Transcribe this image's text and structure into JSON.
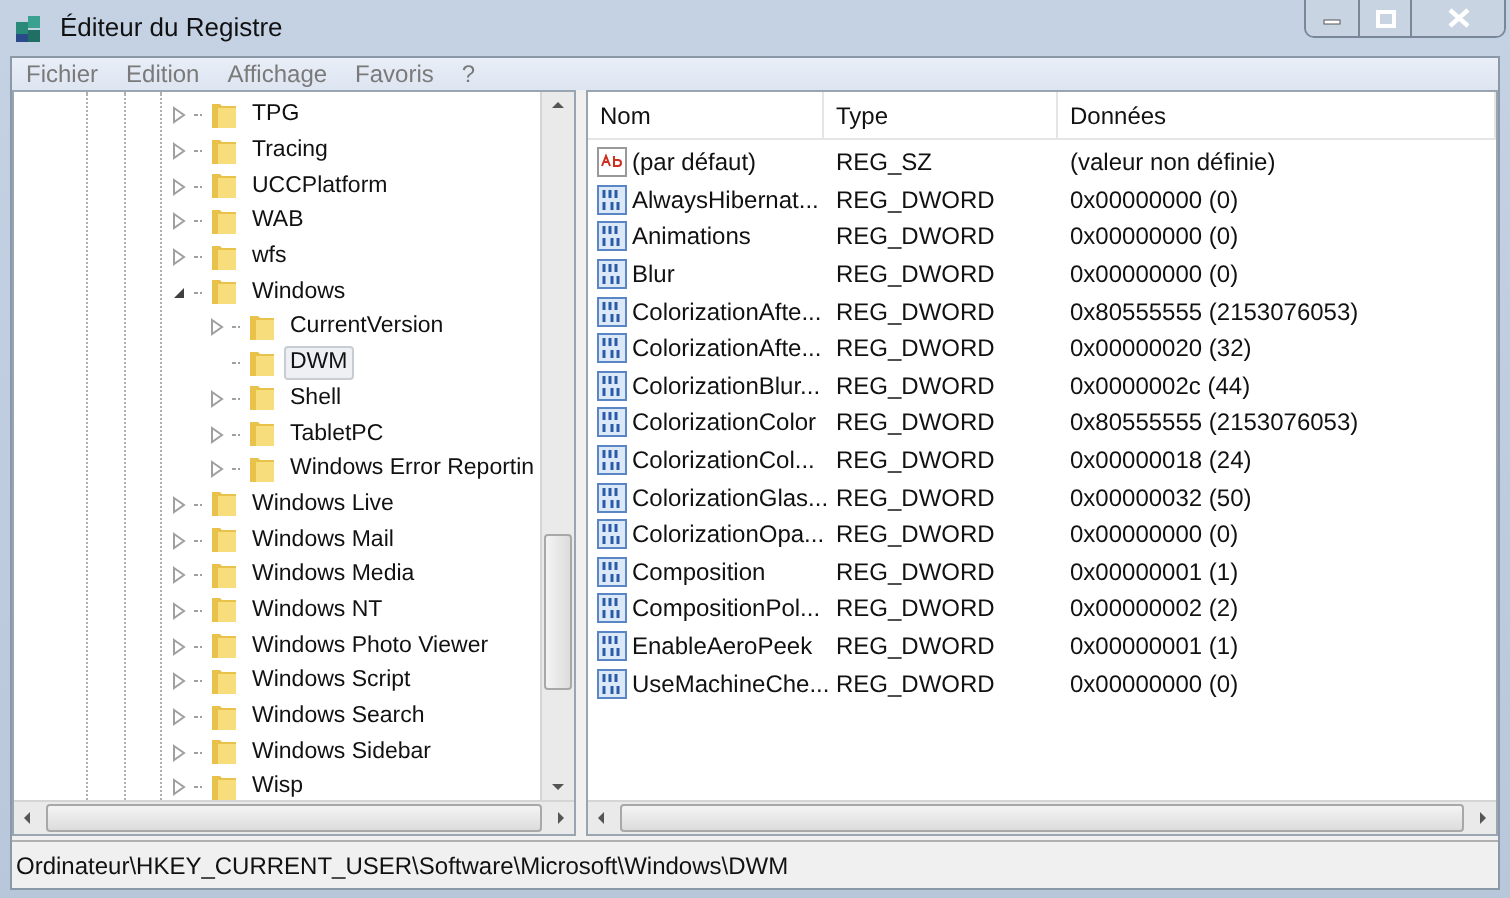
{
  "window": {
    "title": "Éditeur du Registre"
  },
  "menu": [
    "Fichier",
    "Edition",
    "Affichage",
    "Favoris",
    "?"
  ],
  "tree": [
    {
      "label": "TPG",
      "has_children": true,
      "expanded": false,
      "selected": false
    },
    {
      "label": "Tracing",
      "has_children": true,
      "expanded": false,
      "selected": false
    },
    {
      "label": "UCCPlatform",
      "has_children": true,
      "expanded": false,
      "selected": false
    },
    {
      "label": "WAB",
      "has_children": true,
      "expanded": false,
      "selected": false
    },
    {
      "label": "wfs",
      "has_children": true,
      "expanded": false,
      "selected": false
    },
    {
      "label": "Windows",
      "has_children": true,
      "expanded": true,
      "selected": false,
      "children": [
        {
          "label": "CurrentVersion",
          "has_children": true,
          "expanded": false,
          "selected": false
        },
        {
          "label": "DWM",
          "has_children": false,
          "selected": true
        },
        {
          "label": "Shell",
          "has_children": true,
          "expanded": false,
          "selected": false
        },
        {
          "label": "TabletPC",
          "has_children": true,
          "expanded": false,
          "selected": false
        },
        {
          "label": "Windows Error Reportin",
          "has_children": true,
          "expanded": false,
          "selected": false
        }
      ]
    },
    {
      "label": "Windows Live",
      "has_children": true,
      "expanded": false,
      "selected": false
    },
    {
      "label": "Windows Mail",
      "has_children": true,
      "expanded": false,
      "selected": false
    },
    {
      "label": "Windows Media",
      "has_children": true,
      "expanded": false,
      "selected": false
    },
    {
      "label": "Windows NT",
      "has_children": true,
      "expanded": false,
      "selected": false
    },
    {
      "label": "Windows Photo Viewer",
      "has_children": true,
      "expanded": false,
      "selected": false
    },
    {
      "label": "Windows Script",
      "has_children": true,
      "expanded": false,
      "selected": false
    },
    {
      "label": "Windows Search",
      "has_children": true,
      "expanded": false,
      "selected": false
    },
    {
      "label": "Windows Sidebar",
      "has_children": true,
      "expanded": false,
      "selected": false
    },
    {
      "label": "Wisp",
      "has_children": true,
      "expanded": false,
      "selected": false
    }
  ],
  "table": {
    "columns": [
      "Nom",
      "Type",
      "Données"
    ],
    "rows": [
      {
        "kind": "string",
        "name": "(par défaut)",
        "type": "REG_SZ",
        "data": "(valeur non définie)"
      },
      {
        "kind": "dword",
        "name": "AlwaysHibernat...",
        "type": "REG_DWORD",
        "data": "0x00000000 (0)"
      },
      {
        "kind": "dword",
        "name": "Animations",
        "type": "REG_DWORD",
        "data": "0x00000000 (0)"
      },
      {
        "kind": "dword",
        "name": "Blur",
        "type": "REG_DWORD",
        "data": "0x00000000 (0)"
      },
      {
        "kind": "dword",
        "name": "ColorizationAfte...",
        "type": "REG_DWORD",
        "data": "0x80555555 (2153076053)"
      },
      {
        "kind": "dword",
        "name": "ColorizationAfte...",
        "type": "REG_DWORD",
        "data": "0x00000020 (32)"
      },
      {
        "kind": "dword",
        "name": "ColorizationBlur...",
        "type": "REG_DWORD",
        "data": "0x0000002c (44)"
      },
      {
        "kind": "dword",
        "name": "ColorizationColor",
        "type": "REG_DWORD",
        "data": "0x80555555 (2153076053)"
      },
      {
        "kind": "dword",
        "name": "ColorizationCol...",
        "type": "REG_DWORD",
        "data": "0x00000018 (24)"
      },
      {
        "kind": "dword",
        "name": "ColorizationGlas...",
        "type": "REG_DWORD",
        "data": "0x00000032 (50)"
      },
      {
        "kind": "dword",
        "name": "ColorizationOpa...",
        "type": "REG_DWORD",
        "data": "0x00000000 (0)"
      },
      {
        "kind": "dword",
        "name": "Composition",
        "type": "REG_DWORD",
        "data": "0x00000001 (1)"
      },
      {
        "kind": "dword",
        "name": "CompositionPol...",
        "type": "REG_DWORD",
        "data": "0x00000002 (2)"
      },
      {
        "kind": "dword",
        "name": "EnableAeroPeek",
        "type": "REG_DWORD",
        "data": "0x00000001 (1)"
      },
      {
        "kind": "dword",
        "name": "UseMachineChe...",
        "type": "REG_DWORD",
        "data": "0x00000000 (0)"
      }
    ]
  },
  "status_bar": "Ordinateur\\HKEY_CURRENT_USER\\Software\\Microsoft\\Windows\\DWM"
}
